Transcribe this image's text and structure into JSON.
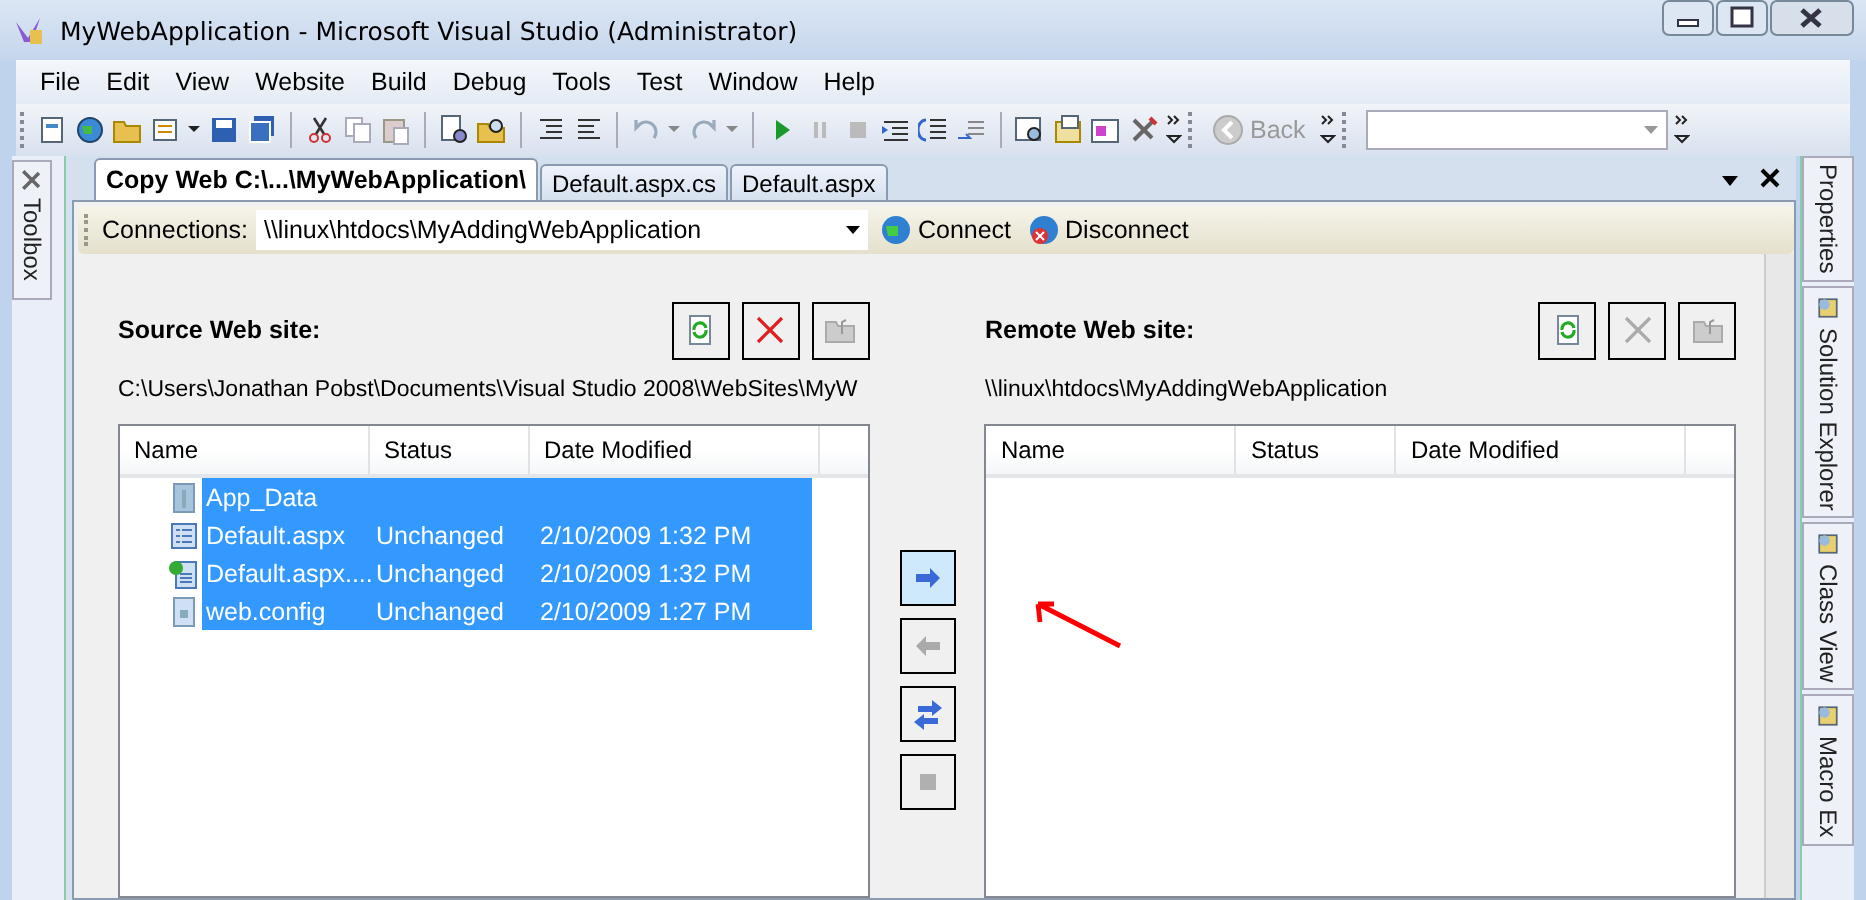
{
  "window": {
    "title": "MyWebApplication - Microsoft Visual Studio (Administrator)"
  },
  "menu": [
    "File",
    "Edit",
    "View",
    "Website",
    "Build",
    "Debug",
    "Tools",
    "Test",
    "Window",
    "Help"
  ],
  "toolbar": {
    "back_button": {
      "label": "Back",
      "disabled": true
    }
  },
  "left_panels": [
    "Toolbox"
  ],
  "right_panels": [
    "Properties",
    "Solution Explorer",
    "Class View",
    "Macro Ex"
  ],
  "tabs": [
    {
      "label": "Copy Web C:\\...\\MyWebApplication\\",
      "selected": true
    },
    {
      "label": "Default.aspx.cs",
      "selected": false
    },
    {
      "label": "Default.aspx",
      "selected": false
    }
  ],
  "connections": {
    "label": "Connections:",
    "value": "\\\\linux\\htdocs\\MyAddingWebApplication",
    "connect": "Connect",
    "disconnect": "Disconnect"
  },
  "sites": [
    {
      "title": "Source Web site:",
      "path": "C:\\Users\\Jonathan Pobst\\Documents\\Visual Studio 2008\\WebSites\\MyW",
      "actions": [
        {
          "kind": "refresh",
          "disabled": false
        },
        {
          "kind": "delete",
          "disabled": false
        },
        {
          "kind": "folder-up",
          "disabled": true
        }
      ],
      "columns": [
        "Name",
        "Status",
        "Date Modified"
      ],
      "rows": [
        {
          "kind": "folder",
          "name": "App_Data",
          "selected": true
        },
        {
          "kind": "page",
          "name": "Default.aspx",
          "status": "Unchanged",
          "date": "2/10/2009 1:32 PM",
          "selected": true
        },
        {
          "kind": "code",
          "name": "Default.aspx....",
          "status": "Unchanged",
          "date": "2/10/2009 1:32 PM",
          "selected": true
        },
        {
          "kind": "config",
          "name": "web.config",
          "status": "Unchanged",
          "date": "2/10/2009 1:27 PM",
          "selected": true
        }
      ]
    },
    {
      "title": "Remote Web site:",
      "path": "\\\\linux\\htdocs\\MyAddingWebApplication",
      "actions": [
        {
          "kind": "refresh",
          "disabled": false
        },
        {
          "kind": "delete",
          "disabled": true
        },
        {
          "kind": "folder-up",
          "disabled": true
        }
      ],
      "columns": [
        "Name",
        "Status",
        "Date Modified"
      ]
    }
  ],
  "transfer_buttons": [
    {
      "kind": "copy-right",
      "selected": true,
      "disabled": false
    },
    {
      "kind": "copy-left",
      "selected": false,
      "disabled": true
    },
    {
      "kind": "sync",
      "selected": false,
      "disabled": false
    },
    {
      "kind": "stop",
      "selected": false,
      "disabled": true
    }
  ]
}
